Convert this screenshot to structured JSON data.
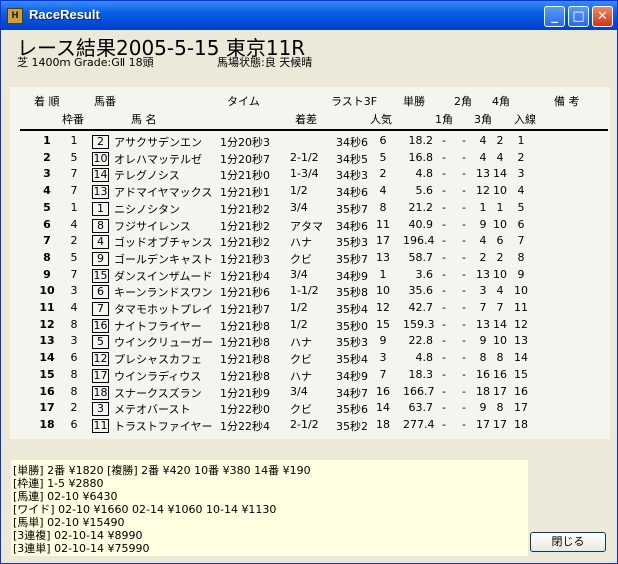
{
  "window": {
    "title": "RaceResult",
    "icon": "horse-racing-app-icon",
    "controls": {
      "minimize": "_",
      "maximize": "□",
      "close": "✕"
    }
  },
  "race": {
    "title": "レース結果2005-5-15 東京11R",
    "info": "芝 1400ｍ Grade:GⅡ  18頭",
    "track": "馬場状態:良   天候晴"
  },
  "table": {
    "headers": {
      "rank": "着 順",
      "horse_no": "馬番",
      "time": "タイム",
      "last3f": "ラスト3F",
      "win": "単勝",
      "corner2": "2角",
      "corner4": "4角",
      "remarks": "備 考",
      "frame": "枠番",
      "name": "馬  名",
      "margin": "着差",
      "popularity": "人気",
      "corner1": "1角",
      "corner3": "3角",
      "finish": "入線"
    },
    "rows": [
      {
        "rank": "1",
        "frame": "1",
        "num": "2",
        "name": "アサクサデンエン",
        "time": "1分20秒3",
        "margin": "",
        "last3f": "34秒6",
        "pop": "6",
        "odds": "18.2",
        "c1": "-",
        "c2": "-",
        "c3": "4",
        "c4": "2",
        "fin": "1"
      },
      {
        "rank": "2",
        "frame": "5",
        "num": "10",
        "name": "オレハマッテルゼ",
        "time": "1分20秒7",
        "margin": "2-1/2",
        "last3f": "34秒5",
        "pop": "5",
        "odds": "16.8",
        "c1": "-",
        "c2": "-",
        "c3": "4",
        "c4": "4",
        "fin": "2"
      },
      {
        "rank": "3",
        "frame": "7",
        "num": "14",
        "name": "テレグノシス",
        "time": "1分21秒0",
        "margin": "1-3/4",
        "last3f": "34秒3",
        "pop": "2",
        "odds": "4.8",
        "c1": "-",
        "c2": "-",
        "c3": "13",
        "c4": "14",
        "fin": "3"
      },
      {
        "rank": "4",
        "frame": "7",
        "num": "13",
        "name": "アドマイヤマックス",
        "time": "1分21秒1",
        "margin": "1/2",
        "last3f": "34秒6",
        "pop": "4",
        "odds": "5.6",
        "c1": "-",
        "c2": "-",
        "c3": "12",
        "c4": "10",
        "fin": "4"
      },
      {
        "rank": "5",
        "frame": "1",
        "num": "1",
        "name": "ニシノシタン",
        "time": "1分21秒2",
        "margin": "3/4",
        "last3f": "35秒7",
        "pop": "8",
        "odds": "21.2",
        "c1": "-",
        "c2": "-",
        "c3": "1",
        "c4": "1",
        "fin": "5"
      },
      {
        "rank": "6",
        "frame": "4",
        "num": "8",
        "name": "フジサイレンス",
        "time": "1分21秒2",
        "margin": "アタマ",
        "last3f": "34秒6",
        "pop": "11",
        "odds": "40.9",
        "c1": "-",
        "c2": "-",
        "c3": "9",
        "c4": "10",
        "fin": "6"
      },
      {
        "rank": "7",
        "frame": "2",
        "num": "4",
        "name": "ゴッドオブチャンス",
        "time": "1分21秒2",
        "margin": "ハナ",
        "last3f": "35秒3",
        "pop": "17",
        "odds": "196.4",
        "c1": "-",
        "c2": "-",
        "c3": "4",
        "c4": "6",
        "fin": "7"
      },
      {
        "rank": "8",
        "frame": "5",
        "num": "9",
        "name": "ゴールデンキャスト",
        "time": "1分21秒3",
        "margin": "クビ",
        "last3f": "35秒7",
        "pop": "13",
        "odds": "58.7",
        "c1": "-",
        "c2": "-",
        "c3": "2",
        "c4": "2",
        "fin": "8"
      },
      {
        "rank": "9",
        "frame": "7",
        "num": "15",
        "name": "ダンスインザムード",
        "time": "1分21秒4",
        "margin": "3/4",
        "last3f": "34秒9",
        "pop": "1",
        "odds": "3.6",
        "c1": "-",
        "c2": "-",
        "c3": "13",
        "c4": "10",
        "fin": "9"
      },
      {
        "rank": "10",
        "frame": "3",
        "num": "6",
        "name": "キーンランドスワン",
        "time": "1分21秒6",
        "margin": "1-1/2",
        "last3f": "35秒8",
        "pop": "10",
        "odds": "35.6",
        "c1": "-",
        "c2": "-",
        "c3": "3",
        "c4": "4",
        "fin": "10"
      },
      {
        "rank": "11",
        "frame": "4",
        "num": "7",
        "name": "タマモホットプレイ",
        "time": "1分21秒7",
        "margin": "1/2",
        "last3f": "35秒4",
        "pop": "12",
        "odds": "42.7",
        "c1": "-",
        "c2": "-",
        "c3": "7",
        "c4": "7",
        "fin": "11"
      },
      {
        "rank": "12",
        "frame": "8",
        "num": "16",
        "name": "ナイトフライヤー",
        "time": "1分21秒8",
        "margin": "1/2",
        "last3f": "35秒0",
        "pop": "15",
        "odds": "159.3",
        "c1": "-",
        "c2": "-",
        "c3": "13",
        "c4": "14",
        "fin": "12"
      },
      {
        "rank": "13",
        "frame": "3",
        "num": "5",
        "name": "ウインクリューガー",
        "time": "1分21秒8",
        "margin": "ハナ",
        "last3f": "35秒3",
        "pop": "9",
        "odds": "22.8",
        "c1": "-",
        "c2": "-",
        "c3": "9",
        "c4": "10",
        "fin": "13"
      },
      {
        "rank": "14",
        "frame": "6",
        "num": "12",
        "name": "プレシャスカフェ",
        "time": "1分21秒8",
        "margin": "クビ",
        "last3f": "35秒4",
        "pop": "3",
        "odds": "4.8",
        "c1": "-",
        "c2": "-",
        "c3": "8",
        "c4": "8",
        "fin": "14"
      },
      {
        "rank": "15",
        "frame": "8",
        "num": "17",
        "name": "ウインラディウス",
        "time": "1分21秒8",
        "margin": "ハナ",
        "last3f": "34秒9",
        "pop": "7",
        "odds": "18.3",
        "c1": "-",
        "c2": "-",
        "c3": "16",
        "c4": "16",
        "fin": "15"
      },
      {
        "rank": "16",
        "frame": "8",
        "num": "18",
        "name": "スナークスズラン",
        "time": "1分21秒9",
        "margin": "3/4",
        "last3f": "34秒7",
        "pop": "16",
        "odds": "166.7",
        "c1": "-",
        "c2": "-",
        "c3": "18",
        "c4": "17",
        "fin": "16"
      },
      {
        "rank": "17",
        "frame": "2",
        "num": "3",
        "name": "メテオバースト",
        "time": "1分22秒0",
        "margin": "クビ",
        "last3f": "35秒6",
        "pop": "14",
        "odds": "63.7",
        "c1": "-",
        "c2": "-",
        "c3": "9",
        "c4": "8",
        "fin": "17"
      },
      {
        "rank": "18",
        "frame": "6",
        "num": "11",
        "name": "トラストファイヤー",
        "time": "1分22秒4",
        "margin": "2-1/2",
        "last3f": "35秒2",
        "pop": "18",
        "odds": "277.4",
        "c1": "-",
        "c2": "-",
        "c3": "17",
        "c4": "17",
        "fin": "18"
      }
    ]
  },
  "payouts": [
    "[単勝] 2番 ¥1820     [複勝] 2番 ¥420   10番 ¥380   14番 ¥190",
    "[枠連] 1-5 ¥2880",
    "[馬連] 02-10 ¥6430",
    "[ワイド] 02-10 ¥1660   02-14 ¥1060   10-14 ¥1130",
    "[馬単] 02-10 ¥15490",
    "[3連複] 02-10-14 ¥8990",
    "[3連単] 02-10-14 ¥75990"
  ],
  "close_label": "閉じる"
}
